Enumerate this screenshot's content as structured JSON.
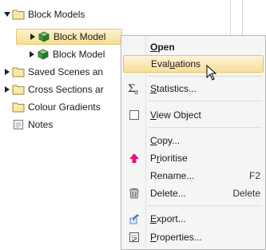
{
  "tree": {
    "items": [
      {
        "label": "Block Models",
        "icon": "folder-icon",
        "expanded": true
      },
      {
        "label": "Block Model",
        "icon": "block-model-icon",
        "selected": true
      },
      {
        "label": "Block Model",
        "icon": "block-model-icon"
      },
      {
        "label": "Saved Scenes an",
        "icon": "folder-icon"
      },
      {
        "label": "Cross Sections ar",
        "icon": "folder-icon"
      },
      {
        "label": "Colour Gradients",
        "icon": "folder-icon"
      },
      {
        "label": "Notes",
        "icon": "notes-icon"
      }
    ]
  },
  "menu": {
    "open": {
      "pre": "",
      "ul": "O",
      "post": "pen"
    },
    "evaluations": {
      "pre": "Eval",
      "ul": "u",
      "post": "ations"
    },
    "statistics": {
      "pre": "",
      "ul": "S",
      "post": "tatistics..."
    },
    "view_object": {
      "pre": "",
      "ul": "V",
      "post": "iew Object"
    },
    "copy": {
      "pre": "",
      "ul": "C",
      "post": "opy..."
    },
    "prioritise": {
      "pre": "P",
      "ul": "r",
      "post": "ioritise"
    },
    "rename": {
      "label": "Rename...",
      "shortcut": "F2"
    },
    "delete": {
      "label": "Delete...",
      "shortcut": "Delete"
    },
    "export": {
      "pre": "",
      "ul": "E",
      "post": "xport..."
    },
    "properties": {
      "pre": "",
      "ul": "P",
      "post": "roperties..."
    }
  },
  "colors": {
    "folder": "#f0d56a",
    "block_model": "#3c9b3c",
    "prioritise_arrow": "#e0177a",
    "highlight": "#f8df9a"
  }
}
